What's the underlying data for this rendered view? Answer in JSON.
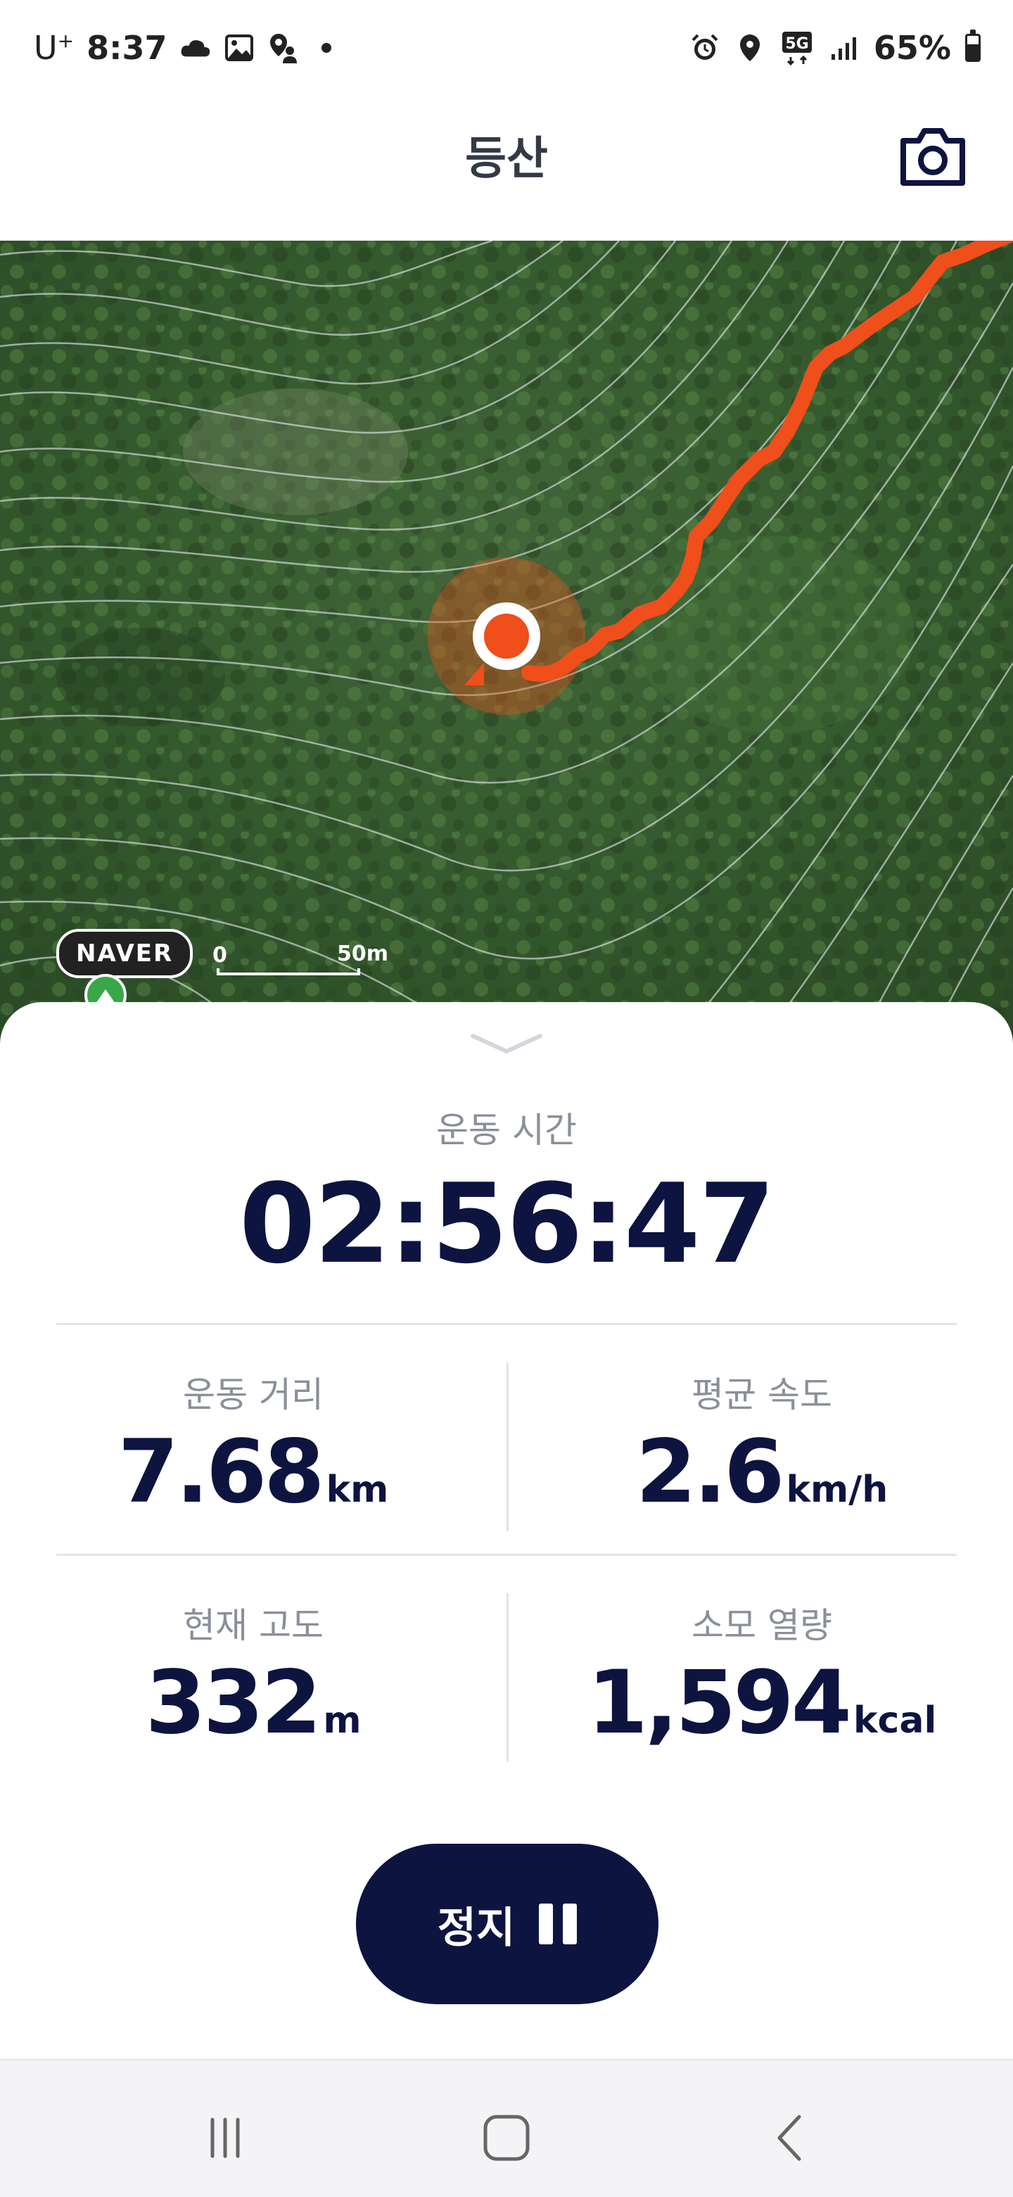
{
  "status_bar": {
    "carrier": "U",
    "carrier_sup": "+",
    "time": "8:37",
    "battery": "65%",
    "battery_level": 0.65,
    "icons": [
      "cloud-icon",
      "gallery-icon",
      "location-person-icon",
      "dot-icon",
      "alarm-icon",
      "location-pin-icon",
      "5g-icon",
      "signal-icon",
      "battery-icon"
    ]
  },
  "header": {
    "title": "등산",
    "camera_icon": "camera-icon"
  },
  "map": {
    "provider": "NAVER",
    "scale_start": "0",
    "scale_end": "50m",
    "route_color": "#f04e1a",
    "location_color": "#f04e1a"
  },
  "workout": {
    "time_label": "운동 시간",
    "time_value": "02:56:47",
    "distance": {
      "label": "운동 거리",
      "value": "7.68",
      "unit": "km"
    },
    "avg_speed": {
      "label": "평균 속도",
      "value": "2.6",
      "unit": "km/h"
    },
    "altitude": {
      "label": "현재 고도",
      "value": "332",
      "unit": "m"
    },
    "calories": {
      "label": "소모 열량",
      "value": "1,594",
      "unit": "kcal"
    }
  },
  "pause_button": {
    "label": "정지"
  },
  "colors": {
    "primary": "#0d1440",
    "accent": "#f04e1a",
    "label": "#8a8f9a"
  }
}
